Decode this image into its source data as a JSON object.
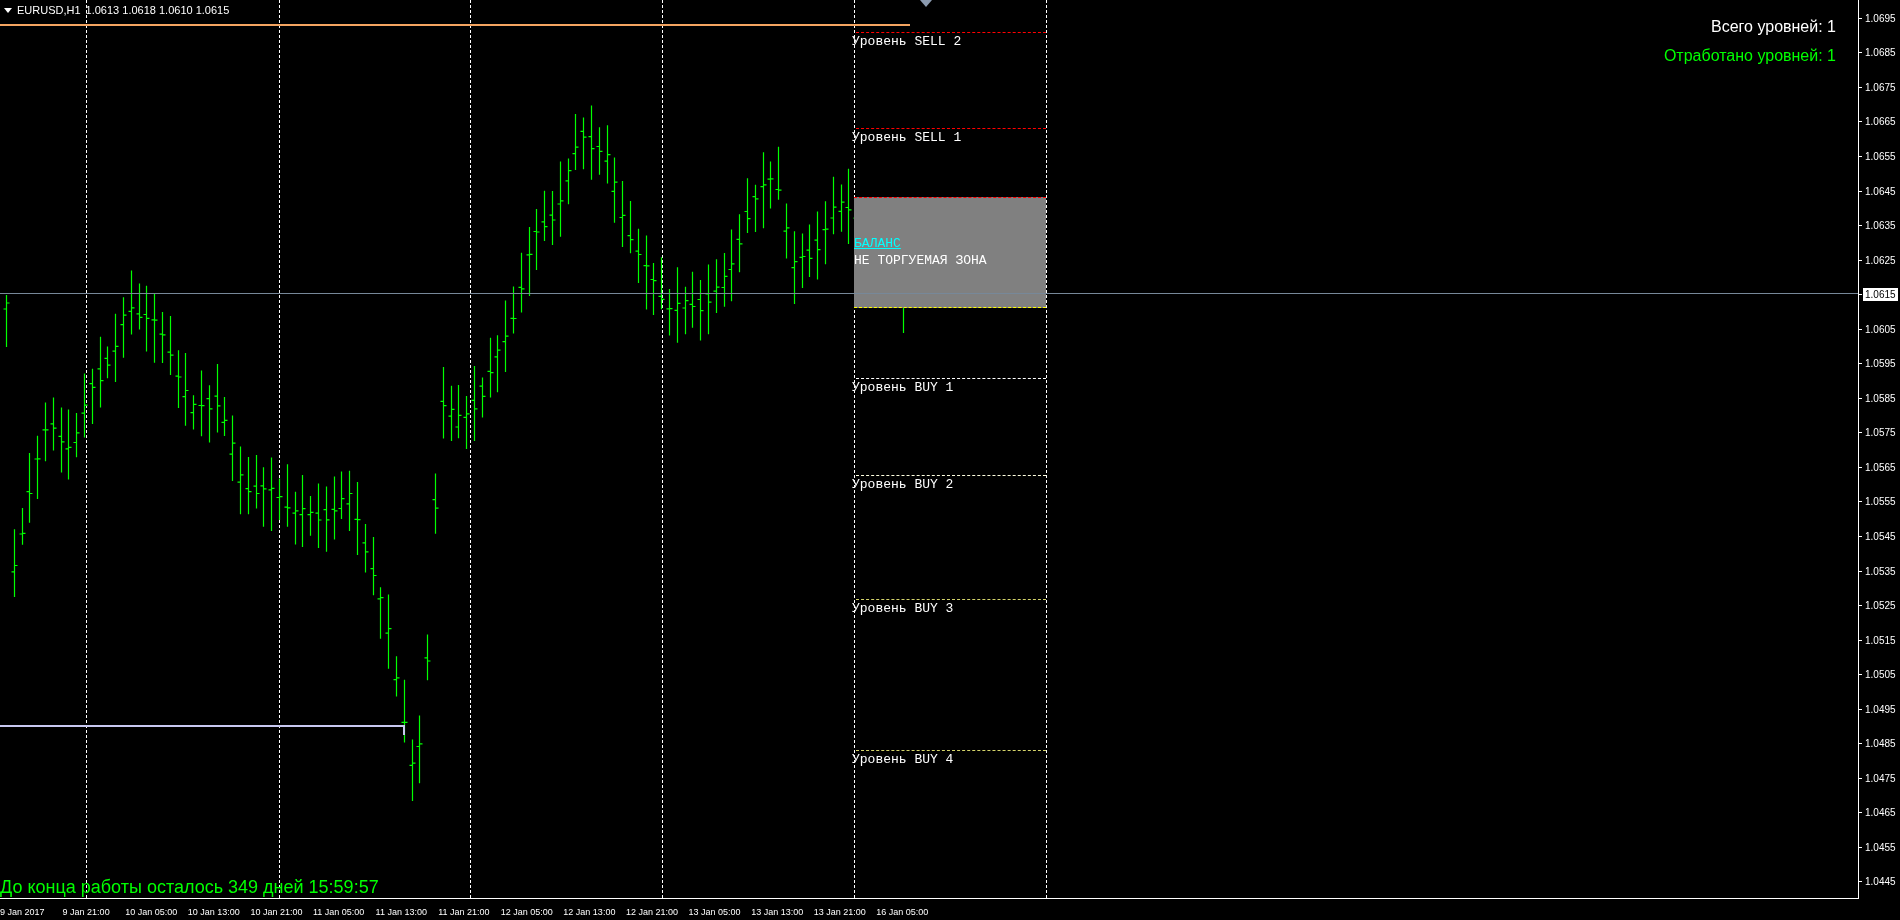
{
  "header": {
    "symbol": "EURUSD,H1",
    "prices": "1.0613 1.0618 1.0610 1.0615"
  },
  "stats": [
    {
      "text": "Всего уровней: 1",
      "color": "#ffffff"
    },
    {
      "text": "Отработано уровней: 1",
      "color": "#00ff00"
    }
  ],
  "levels": [
    {
      "label": "Уровень SELL 2",
      "color": "#ff0000"
    },
    {
      "label": "Уровень SELL 1",
      "color": "#ff0000"
    },
    {
      "label": "Уровень BUY 1",
      "color": "#ffffff"
    },
    {
      "label": "Уровень BUY 2",
      "color": "#ffffe0"
    },
    {
      "label": "Уровень BUY 3",
      "color": "#d4d46a"
    },
    {
      "label": "Уровень BUY 4",
      "color": "#d4d46a"
    }
  ],
  "zone": {
    "title": "БАЛАНС",
    "subtitle": "НЕ ТОРГУЕМАЯ ЗОНА"
  },
  "price_axis": [
    {
      "text": "1.0695",
      "kind": "tick"
    },
    {
      "text": "1.0685",
      "kind": "tick"
    },
    {
      "text": "1.0675",
      "kind": "tick"
    },
    {
      "text": "1.0665",
      "kind": "tick"
    },
    {
      "text": "1.0655",
      "kind": "tick"
    },
    {
      "text": "1.0645",
      "kind": "tick"
    },
    {
      "text": "1.0635",
      "kind": "tick"
    },
    {
      "text": "1.0625",
      "kind": "tick"
    },
    {
      "text": "1.0615",
      "kind": "current"
    },
    {
      "text": "1.0605",
      "kind": "tick"
    },
    {
      "text": "1.0595",
      "kind": "tick"
    },
    {
      "text": "1.0585",
      "kind": "tick"
    },
    {
      "text": "1.0575",
      "kind": "tick"
    },
    {
      "text": "1.0565",
      "kind": "tick"
    },
    {
      "text": "1.0555",
      "kind": "tick"
    },
    {
      "text": "1.0545",
      "kind": "tick"
    },
    {
      "text": "1.0535",
      "kind": "tick"
    },
    {
      "text": "1.0525",
      "kind": "tick"
    },
    {
      "text": "1.0515",
      "kind": "tick"
    },
    {
      "text": "1.0505",
      "kind": "tick"
    },
    {
      "text": "1.0495",
      "kind": "tick"
    },
    {
      "text": "1.0485",
      "kind": "tick"
    },
    {
      "text": "1.0475",
      "kind": "tick"
    },
    {
      "text": "1.0465",
      "kind": "tick"
    },
    {
      "text": "1.0455",
      "kind": "tick"
    },
    {
      "text": "1.0445",
      "kind": "tick"
    }
  ],
  "time_axis": [
    "9 Jan 2017",
    "9 Jan 21:00",
    "10 Jan 05:00",
    "10 Jan 13:00",
    "10 Jan 21:00",
    "11 Jan 05:00",
    "11 Jan 13:00",
    "11 Jan 21:00",
    "12 Jan 05:00",
    "12 Jan 13:00",
    "12 Jan 21:00",
    "13 Jan 05:00",
    "13 Jan 13:00",
    "13 Jan 21:00",
    "16 Jan 05:00"
  ],
  "countdown": "До конца работы осталось 349 дней 15:59:57"
}
